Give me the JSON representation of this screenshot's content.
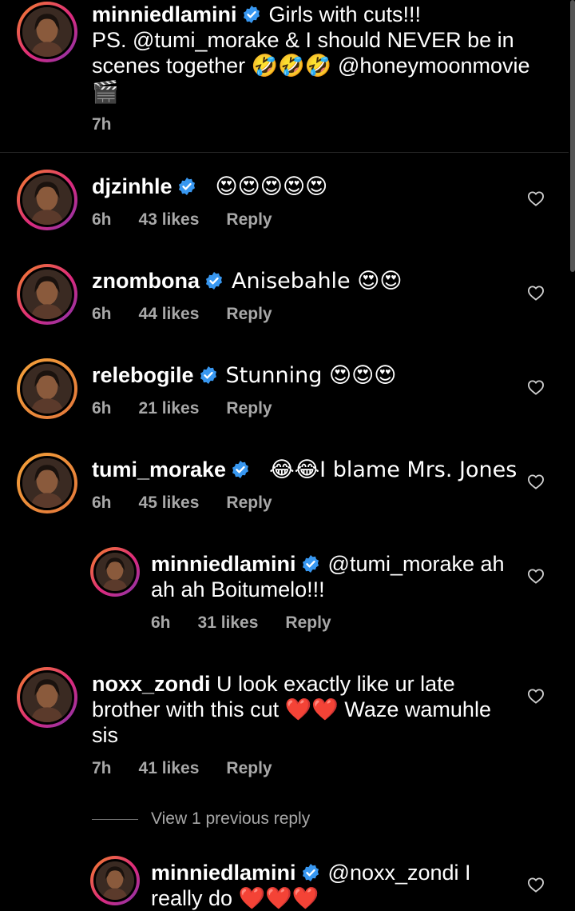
{
  "caption": {
    "username": "minniedlamini",
    "line1": "Girls with cuts!!!",
    "line2": "PS. @tumi_morake & I should NEVER be in",
    "line3_text": "scenes together",
    "line3_emoji": "🤣🤣🤣",
    "line3_mention": "@honeymoonmovie",
    "line4": "🎬",
    "time": "7h"
  },
  "comments": [
    {
      "username": "djzinhle",
      "text": "😍😍😍😍😍",
      "time": "6h",
      "likes": "43 likes",
      "reply": "Reply"
    },
    {
      "username": "znombona",
      "text": "Anisebahle 😍😍",
      "time": "6h",
      "likes": "44 likes",
      "reply": "Reply"
    },
    {
      "username": "relebogile",
      "text": "Stunning 😍😍😍",
      "time": "6h",
      "likes": "21 likes",
      "reply": "Reply"
    },
    {
      "username": "tumi_morake",
      "text": "😂😂I blame Mrs. Jones",
      "time": "6h",
      "likes": "45 likes",
      "reply": "Reply"
    }
  ],
  "reply1": {
    "username": "minniedlamini",
    "line1": "@tumi_morake ah",
    "line2": "ah ah Boitumelo!!!",
    "time": "6h",
    "likes": "31 likes",
    "reply": "Reply"
  },
  "comment5": {
    "username": "noxx_zondi",
    "line1": "U look exactly like ur late",
    "line2_text": "brother with this cut",
    "line2_emoji": "❤️❤️",
    "line2_tail": "Waze wamuhle",
    "line3": "sis",
    "time": "7h",
    "likes": "41 likes",
    "reply": "Reply"
  },
  "view_previous": "View 1 previous reply",
  "reply2": {
    "username": "minniedlamini",
    "line1": "@noxx_zondi I",
    "line2": "really do ❤️❤️❤️"
  },
  "colors": {
    "badge": "#3897f0",
    "meta": "#a8a8a8",
    "heart_stroke": "#cfcfcf"
  }
}
